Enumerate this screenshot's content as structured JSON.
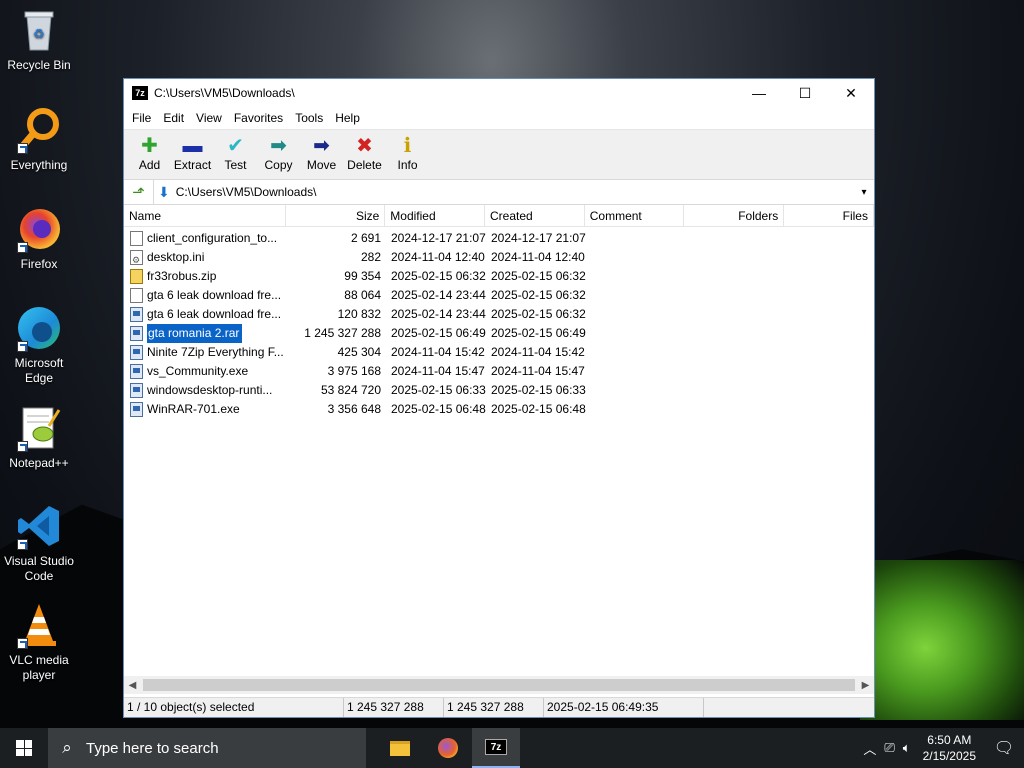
{
  "desktop": {
    "icons": [
      {
        "label": "Recycle Bin",
        "icon": "recycle-bin-icon"
      },
      {
        "label": "Everything",
        "icon": "everything-search-icon"
      },
      {
        "label": "Firefox",
        "icon": "firefox-icon"
      },
      {
        "label": "Microsoft Edge",
        "icon": "edge-icon"
      },
      {
        "label": "Notepad++",
        "icon": "notepad-plus-plus-icon"
      },
      {
        "label": "Visual Studio Code",
        "icon": "vscode-icon"
      },
      {
        "label": "VLC media player",
        "icon": "vlc-icon"
      }
    ]
  },
  "window": {
    "title": "C:\\Users\\VM5\\Downloads\\",
    "app_icon_text": "7z",
    "controls": {
      "minimize": "—",
      "maximize": "☐",
      "close": "✕"
    },
    "menu": [
      "File",
      "Edit",
      "View",
      "Favorites",
      "Tools",
      "Help"
    ],
    "toolbar": [
      {
        "label": "Add",
        "glyph": "✚",
        "color": "#2fa52f"
      },
      {
        "label": "Extract",
        "glyph": "▬",
        "color": "#1b2fa8"
      },
      {
        "label": "Test",
        "glyph": "✔",
        "color": "#2bb7c4"
      },
      {
        "label": "Copy",
        "glyph": "➡",
        "color": "#1f8a86"
      },
      {
        "label": "Move",
        "glyph": "➡",
        "color": "#1b2a8a"
      },
      {
        "label": "Delete",
        "glyph": "✖",
        "color": "#d32222"
      },
      {
        "label": "Info",
        "glyph": "ℹ",
        "color": "#c9a200"
      }
    ],
    "address": {
      "path": "C:\\Users\\VM5\\Downloads\\"
    },
    "columns": {
      "name": "Name",
      "size": "Size",
      "modified": "Modified",
      "created": "Created",
      "comment": "Comment",
      "folders": "Folders",
      "files": "Files"
    },
    "files": [
      {
        "name": "client_configuration_to...",
        "size": "2 691",
        "modified": "2024-12-17 21:07",
        "created": "2024-12-17 21:07",
        "type": "file",
        "selected": false
      },
      {
        "name": "desktop.ini",
        "size": "282",
        "modified": "2024-11-04 12:40",
        "created": "2024-11-04 12:40",
        "type": "ini",
        "selected": false
      },
      {
        "name": "fr33robus.zip",
        "size": "99 354",
        "modified": "2025-02-15 06:32",
        "created": "2025-02-15 06:32",
        "type": "zip",
        "selected": false
      },
      {
        "name": "gta 6 leak download fre...",
        "size": "88 064",
        "modified": "2025-02-14 23:44",
        "created": "2025-02-15 06:32",
        "type": "file",
        "selected": false
      },
      {
        "name": "gta 6 leak download fre...",
        "size": "120 832",
        "modified": "2025-02-14 23:44",
        "created": "2025-02-15 06:32",
        "type": "exe",
        "selected": false
      },
      {
        "name": "gta romania 2.rar",
        "size": "1 245 327 288",
        "modified": "2025-02-15 06:49",
        "created": "2025-02-15 06:49",
        "type": "exe",
        "selected": true
      },
      {
        "name": "Ninite 7Zip Everything F...",
        "size": "425 304",
        "modified": "2024-11-04 15:42",
        "created": "2024-11-04 15:42",
        "type": "exe",
        "selected": false
      },
      {
        "name": "vs_Community.exe",
        "size": "3 975 168",
        "modified": "2024-11-04 15:47",
        "created": "2024-11-04 15:47",
        "type": "exe",
        "selected": false
      },
      {
        "name": "windowsdesktop-runti...",
        "size": "53 824 720",
        "modified": "2025-02-15 06:33",
        "created": "2025-02-15 06:33",
        "type": "exe",
        "selected": false
      },
      {
        "name": "WinRAR-701.exe",
        "size": "3 356 648",
        "modified": "2025-02-15 06:48",
        "created": "2025-02-15 06:48",
        "type": "exe",
        "selected": false
      }
    ],
    "status": {
      "selection": "1 / 10 object(s) selected",
      "size": "1 245 327 288",
      "packed": "1 245 327 288",
      "date": "2025-02-15 06:49:35"
    }
  },
  "taskbar": {
    "search_placeholder": "Type here to search",
    "time": "6:50 AM",
    "date": "2/15/2025"
  }
}
